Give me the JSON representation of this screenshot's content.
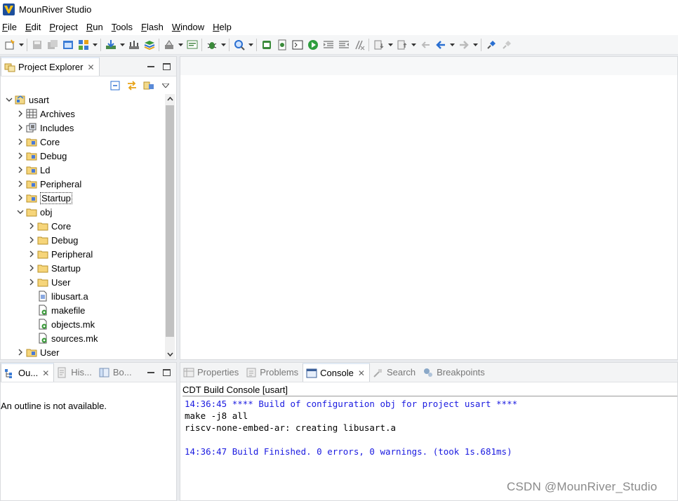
{
  "window": {
    "title": "MounRiver Studio"
  },
  "menu": [
    {
      "pre": "",
      "mn": "F",
      "rest": "ile"
    },
    {
      "pre": "",
      "mn": "E",
      "rest": "dit"
    },
    {
      "pre": "",
      "mn": "P",
      "rest": "roject"
    },
    {
      "pre": "",
      "mn": "R",
      "rest": "un"
    },
    {
      "pre": "",
      "mn": "T",
      "rest": "ools"
    },
    {
      "pre": "",
      "mn": "F",
      "rest": "lash"
    },
    {
      "pre": "",
      "mn": "W",
      "rest": "indow"
    },
    {
      "pre": "",
      "mn": "H",
      "rest": "elp"
    }
  ],
  "project_explorer": {
    "tab_label": "Project Explorer",
    "tree": [
      {
        "label": "usart",
        "depth": 0,
        "expanded": true,
        "icon": "project-icon"
      },
      {
        "label": "Archives",
        "depth": 1,
        "expanded": false,
        "icon": "archives-icon"
      },
      {
        "label": "Includes",
        "depth": 1,
        "expanded": false,
        "icon": "includes-icon"
      },
      {
        "label": "Core",
        "depth": 1,
        "expanded": false,
        "icon": "source-folder-icon"
      },
      {
        "label": "Debug",
        "depth": 1,
        "expanded": false,
        "icon": "source-folder-icon"
      },
      {
        "label": "Ld",
        "depth": 1,
        "expanded": false,
        "icon": "source-folder-icon"
      },
      {
        "label": "Peripheral",
        "depth": 1,
        "expanded": false,
        "icon": "source-folder-icon"
      },
      {
        "label": "Startup",
        "depth": 1,
        "expanded": false,
        "icon": "source-folder-icon",
        "selected": true
      },
      {
        "label": "obj",
        "depth": 1,
        "expanded": true,
        "icon": "folder-icon"
      },
      {
        "label": "Core",
        "depth": 2,
        "expanded": false,
        "icon": "folder-icon"
      },
      {
        "label": "Debug",
        "depth": 2,
        "expanded": false,
        "icon": "folder-icon"
      },
      {
        "label": "Peripheral",
        "depth": 2,
        "expanded": false,
        "icon": "folder-icon"
      },
      {
        "label": "Startup",
        "depth": 2,
        "expanded": false,
        "icon": "folder-icon"
      },
      {
        "label": "User",
        "depth": 2,
        "expanded": false,
        "icon": "folder-icon"
      },
      {
        "label": "libusart.a",
        "depth": 2,
        "leaf": true,
        "icon": "library-file-icon"
      },
      {
        "label": "makefile",
        "depth": 2,
        "leaf": true,
        "icon": "make-file-icon"
      },
      {
        "label": "objects.mk",
        "depth": 2,
        "leaf": true,
        "icon": "make-file-icon"
      },
      {
        "label": "sources.mk",
        "depth": 2,
        "leaf": true,
        "icon": "make-file-icon"
      },
      {
        "label": "User",
        "depth": 1,
        "expanded": false,
        "icon": "source-folder-icon"
      }
    ]
  },
  "outline_area": {
    "tabs": [
      {
        "label": "Ou...",
        "icon": "outline-icon",
        "active": true,
        "closable": true
      },
      {
        "label": "His...",
        "icon": "history-icon",
        "active": false
      },
      {
        "label": "Bo...",
        "icon": "bookmarks-icon",
        "active": false
      }
    ],
    "message": "An outline is not available."
  },
  "bottom_area": {
    "tabs": [
      {
        "label": "Properties",
        "icon": "properties-icon",
        "active": false
      },
      {
        "label": "Problems",
        "icon": "problems-icon",
        "active": false
      },
      {
        "label": "Console",
        "icon": "console-icon",
        "active": true,
        "closable": true
      },
      {
        "label": "Search",
        "icon": "search-icon",
        "active": false
      },
      {
        "label": "Breakpoints",
        "icon": "breakpoints-icon",
        "active": false
      }
    ],
    "console_title": "CDT Build Console [usart]",
    "console_lines": [
      {
        "text": "14:36:45 **** Build of configuration obj for project usart ****",
        "color": "#1a1ae0"
      },
      {
        "text": "make -j8 all",
        "color": "#000000"
      },
      {
        "text": "riscv-none-embed-ar: creating libusart.a",
        "color": "#000000"
      },
      {
        "text": "",
        "color": "#000000"
      },
      {
        "text": "14:36:47 Build Finished. 0 errors, 0 warnings. (took 1s.681ms)",
        "color": "#1a1ae0"
      }
    ]
  },
  "watermark": "CSDN @MounRiver_Studio",
  "colors": {
    "console_info": "#1a1ae0",
    "selection_border": "#333333",
    "panel_border": "#d9dbde",
    "background": "#e9ebee"
  }
}
